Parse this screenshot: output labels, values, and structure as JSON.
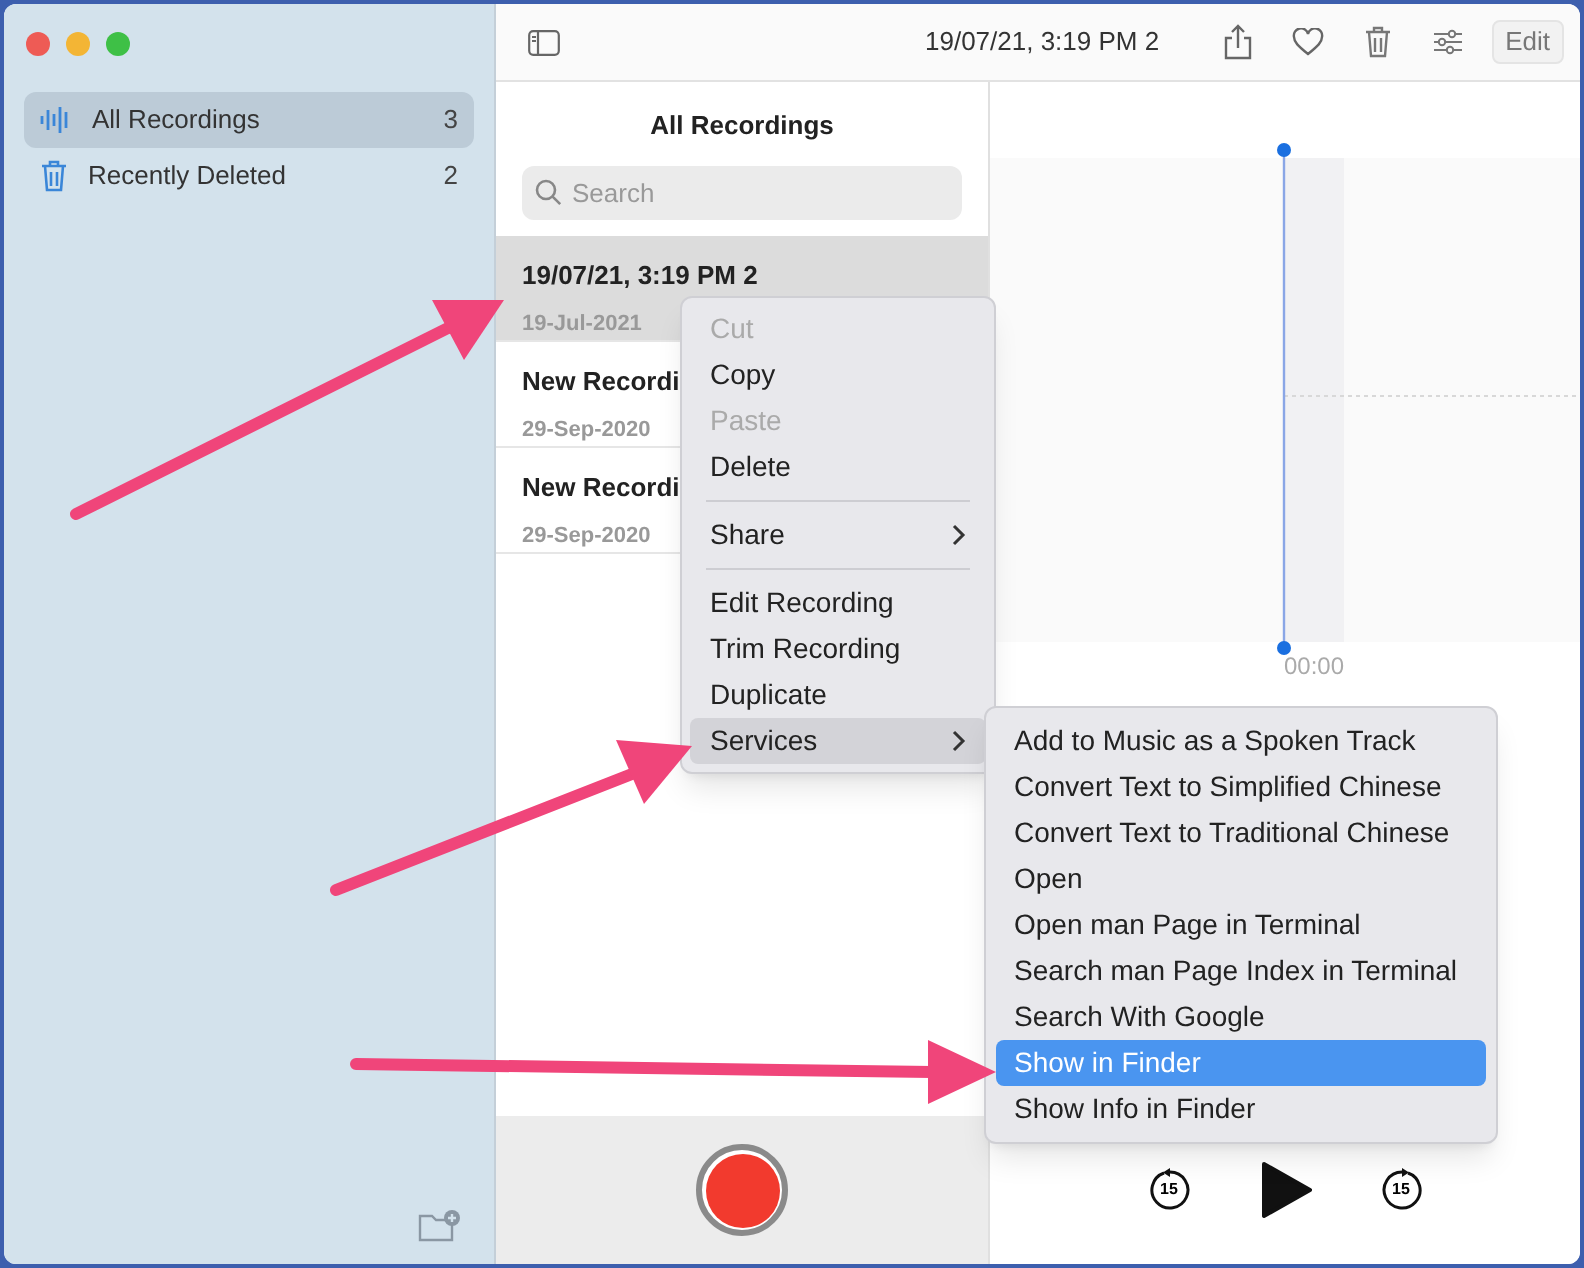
{
  "sidebar": {
    "items": [
      {
        "kind": "waveform",
        "label": "All Recordings",
        "count": "3",
        "selected": true
      },
      {
        "kind": "trash",
        "label": "Recently Deleted",
        "count": "2",
        "selected": false
      }
    ]
  },
  "toolbar": {
    "title": "19/07/21, 3:19 PM 2",
    "edit_button": "Edit"
  },
  "list": {
    "title": "All Recordings",
    "search": {
      "placeholder": "Search"
    },
    "recordings": [
      {
        "title": "19/07/21, 3:19 PM 2",
        "date": "19-Jul-2021",
        "selected": true
      },
      {
        "title": "New Recordi",
        "date": "29-Sep-2020",
        "selected": false
      },
      {
        "title": "New Recordi",
        "date": "29-Sep-2020",
        "selected": false
      }
    ]
  },
  "player": {
    "time": "00:00",
    "skip_back": "15",
    "skip_forward": "15"
  },
  "context_menu": {
    "items": [
      {
        "kind": "item",
        "label": "Cut",
        "disabled": true,
        "submenu": false,
        "selected": false
      },
      {
        "kind": "item",
        "label": "Copy",
        "disabled": false,
        "submenu": false,
        "selected": false
      },
      {
        "kind": "item",
        "label": "Paste",
        "disabled": true,
        "submenu": false,
        "selected": false
      },
      {
        "kind": "item",
        "label": "Delete",
        "disabled": false,
        "submenu": false,
        "selected": false
      },
      {
        "kind": "separator"
      },
      {
        "kind": "item",
        "label": "Share",
        "disabled": false,
        "submenu": true,
        "selected": false
      },
      {
        "kind": "separator"
      },
      {
        "kind": "item",
        "label": "Edit Recording",
        "disabled": false,
        "submenu": false,
        "selected": false
      },
      {
        "kind": "item",
        "label": "Trim Recording",
        "disabled": false,
        "submenu": false,
        "selected": false
      },
      {
        "kind": "item",
        "label": "Duplicate",
        "disabled": false,
        "submenu": false,
        "selected": false
      },
      {
        "kind": "item",
        "label": "Services",
        "disabled": false,
        "submenu": true,
        "selected": true
      }
    ]
  },
  "services_menu": {
    "items": [
      {
        "label": "Add to Music as a Spoken Track",
        "selected": false
      },
      {
        "label": "Convert Text to Simplified Chinese",
        "selected": false
      },
      {
        "label": "Convert Text to Traditional Chinese",
        "selected": false
      },
      {
        "label": "Open",
        "selected": false
      },
      {
        "label": "Open man Page in Terminal",
        "selected": false
      },
      {
        "label": "Search man Page Index in Terminal",
        "selected": false
      },
      {
        "label": "Search With Google",
        "selected": false
      },
      {
        "label": "Show in Finder",
        "selected": true
      },
      {
        "label": "Show Info in Finder",
        "selected": false
      }
    ]
  }
}
